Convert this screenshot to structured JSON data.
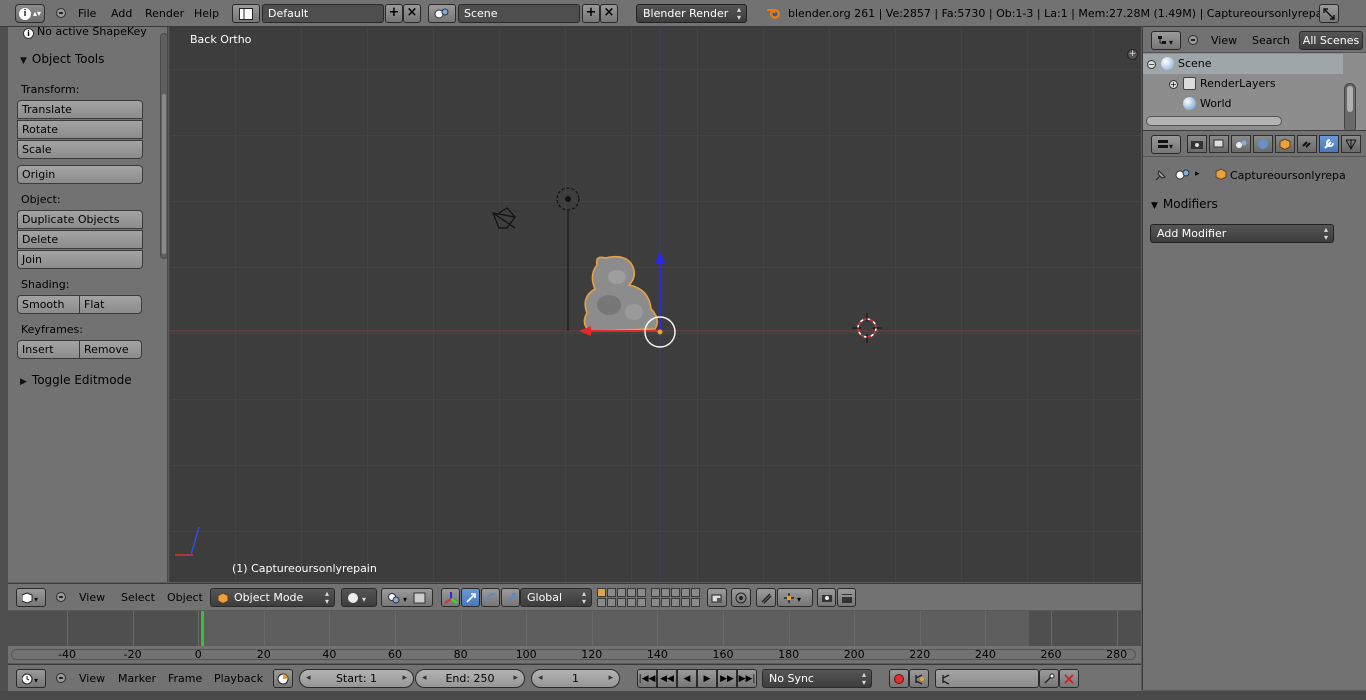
{
  "topbar": {
    "menus": [
      "File",
      "Add",
      "Render",
      "Help"
    ],
    "layout_name": "Default",
    "scene_name": "Scene",
    "render_engine": "Blender Render",
    "stats": "blender.org 261 | Ve:2857 | Fa:5730 | Ob:1-3 | La:1 | Mem:27.28M (1.49M) | Captureoursonlyrepain"
  },
  "toolshelf": {
    "shapekey_note": "No active ShapeKey",
    "panel_title": "Object Tools",
    "transform_label": "Transform:",
    "translate": "Translate",
    "rotate": "Rotate",
    "scale": "Scale",
    "origin": "Origin",
    "object_label": "Object:",
    "duplicate": "Duplicate Objects",
    "delete": "Delete",
    "join": "Join",
    "shading_label": "Shading:",
    "smooth": "Smooth",
    "flat": "Flat",
    "keyframes_label": "Keyframes:",
    "insert": "Insert",
    "remove": "Remove",
    "toggle_editmode": "Toggle Editmode"
  },
  "viewport": {
    "view_name": "Back Ortho",
    "object_label": "(1) Captureoursonlyrepain"
  },
  "outliner": {
    "menus": [
      "View",
      "Search"
    ],
    "filter": "All Scenes",
    "rows": [
      "Scene",
      "RenderLayers",
      "World"
    ]
  },
  "properties": {
    "object_name": "Captureoursonlyrepa",
    "modifiers_title": "Modifiers",
    "add_modifier": "Add Modifier"
  },
  "view_header": {
    "menus": [
      "View",
      "Select",
      "Object"
    ],
    "mode": "Object Mode",
    "orientation": "Global"
  },
  "timeline": {
    "ticks": [
      "-40",
      "-20",
      "0",
      "20",
      "40",
      "60",
      "80",
      "100",
      "120",
      "140",
      "160",
      "180",
      "200",
      "220",
      "240",
      "260",
      "280"
    ],
    "current_frame_marker": 0
  },
  "timeline_header": {
    "menus": [
      "View",
      "Marker",
      "Frame",
      "Playback"
    ],
    "start": "Start: 1",
    "end": "End: 250",
    "current": "1",
    "sync": "No Sync"
  },
  "colors": {
    "accent_selected": "#e8a040",
    "active_tab": "#5a88c8",
    "timeline_cursor": "#35c435"
  }
}
